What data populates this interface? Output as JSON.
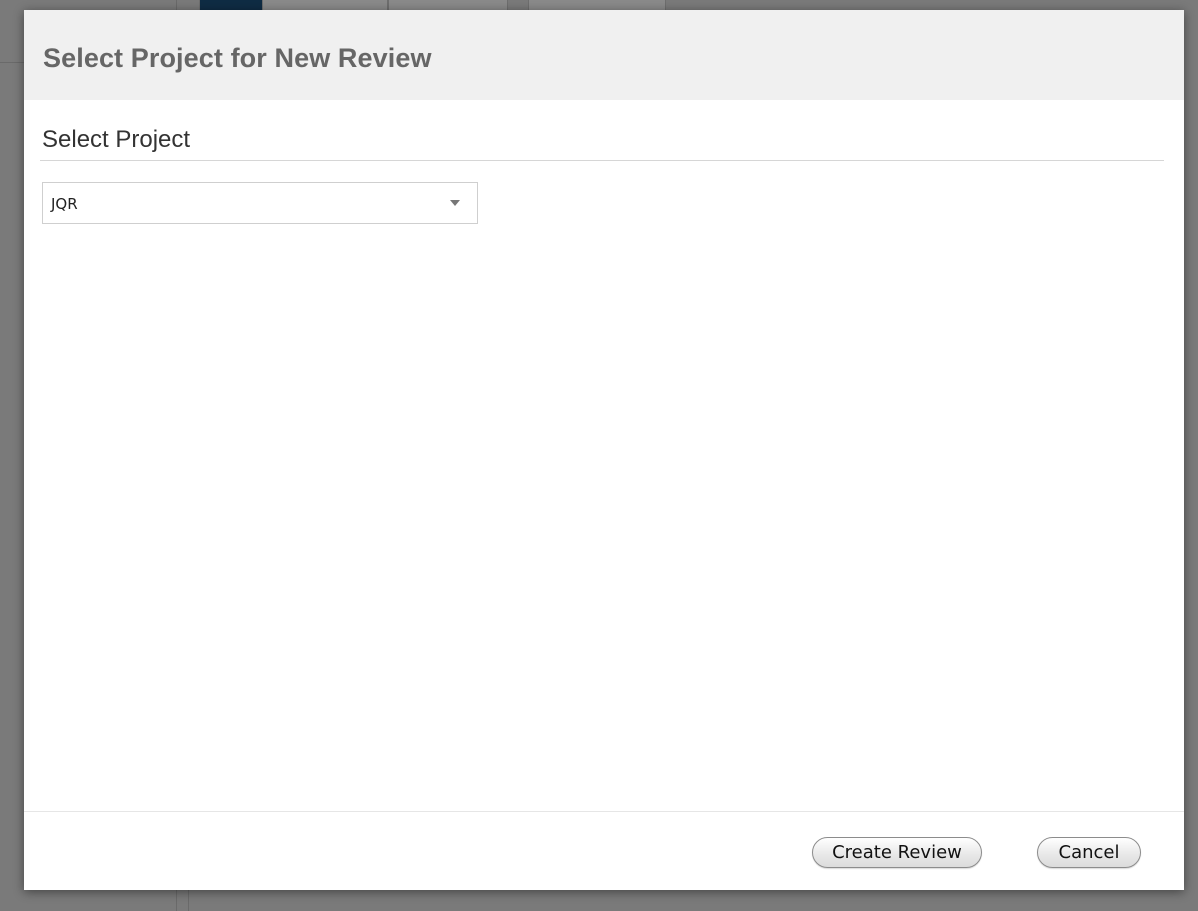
{
  "dialog": {
    "title": "Select Project for New Review",
    "section_heading": "Select Project",
    "project_select": {
      "selected_value": "JQR"
    },
    "buttons": {
      "create_label": "Create Review",
      "cancel_label": "Cancel"
    }
  },
  "icons": {
    "dropdown": "chevron-down-icon"
  },
  "colors": {
    "overlay": "#7a7a7a",
    "header_bg": "#f0f0f0",
    "title_text": "#666666"
  }
}
